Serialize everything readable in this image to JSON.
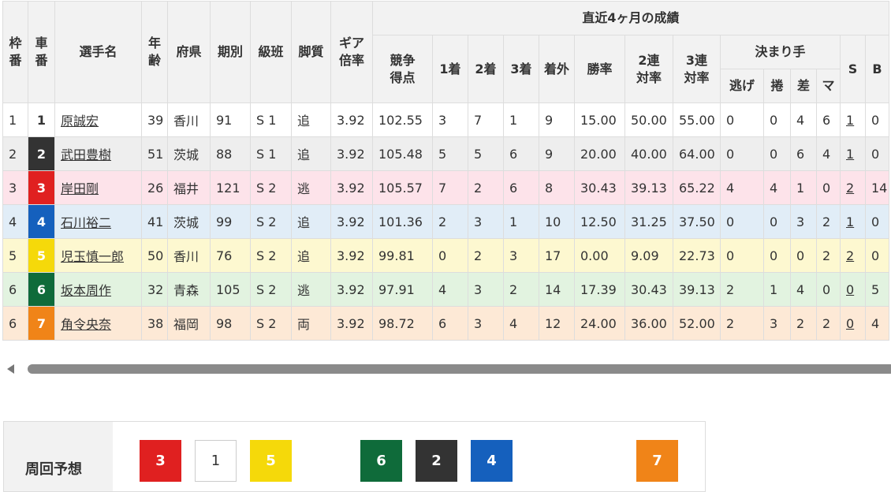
{
  "header": {
    "waku": "枠番",
    "sha": "車番",
    "name": "選手名",
    "age": "年齢",
    "pref": "府県",
    "term": "期別",
    "class": "級班",
    "style": "脚質",
    "gear": "ギア倍率",
    "group": "直近4ヶ月の成績",
    "score": "競争得点",
    "first": "1着",
    "second": "2着",
    "third": "3着",
    "out": "着外",
    "win": "勝率",
    "ren2": "2連対率",
    "ren3": "3連対率",
    "kimarite": "決まり手",
    "nige": "逃げ",
    "makuri": "捲",
    "sashi": "差",
    "mark": "マ",
    "s": "S",
    "b": "B"
  },
  "colors": {
    "car1": "#ffffff",
    "car2": "#333333",
    "car3": "#e02020",
    "car4": "#1560bd",
    "car5": "#f5d90a",
    "car6": "#0f6b3a",
    "car7": "#f08418",
    "row1": "#ffffff",
    "row2": "#eeeeee",
    "row3": "#fde3ea",
    "row4": "#e1edf7",
    "row5": "#fdf8d0",
    "row6": "#e2f3e0",
    "row7": "#fde9d6"
  },
  "rows": [
    {
      "waku": "1",
      "car": "1",
      "name": "原誠宏",
      "age": "39",
      "pref": "香川",
      "term": "91",
      "class": "S 1",
      "style": "追",
      "gear": "3.92",
      "score": "102.55",
      "first": "3",
      "second": "7",
      "third": "1",
      "out": "9",
      "win": "15.00",
      "ren2": "50.00",
      "ren3": "55.00",
      "nige": "0",
      "makuri": "0",
      "sashi": "4",
      "mark": "6",
      "s": "1",
      "b": "0"
    },
    {
      "waku": "2",
      "car": "2",
      "name": "武田豊樹",
      "age": "51",
      "pref": "茨城",
      "term": "88",
      "class": "S 1",
      "style": "追",
      "gear": "3.92",
      "score": "105.48",
      "first": "5",
      "second": "5",
      "third": "6",
      "out": "9",
      "win": "20.00",
      "ren2": "40.00",
      "ren3": "64.00",
      "nige": "0",
      "makuri": "0",
      "sashi": "6",
      "mark": "4",
      "s": "1",
      "b": "0"
    },
    {
      "waku": "3",
      "car": "3",
      "name": "岸田剛",
      "age": "26",
      "pref": "福井",
      "term": "121",
      "class": "S 2",
      "style": "逃",
      "gear": "3.92",
      "score": "105.57",
      "first": "7",
      "second": "2",
      "third": "6",
      "out": "8",
      "win": "30.43",
      "ren2": "39.13",
      "ren3": "65.22",
      "nige": "4",
      "makuri": "4",
      "sashi": "1",
      "mark": "0",
      "s": "2",
      "b": "14"
    },
    {
      "waku": "4",
      "car": "4",
      "name": "石川裕二",
      "age": "41",
      "pref": "茨城",
      "term": "99",
      "class": "S 2",
      "style": "追",
      "gear": "3.92",
      "score": "101.36",
      "first": "2",
      "second": "3",
      "third": "1",
      "out": "10",
      "win": "12.50",
      "ren2": "31.25",
      "ren3": "37.50",
      "nige": "0",
      "makuri": "0",
      "sashi": "3",
      "mark": "2",
      "s": "1",
      "b": "0"
    },
    {
      "waku": "5",
      "car": "5",
      "name": "児玉慎一郎",
      "age": "50",
      "pref": "香川",
      "term": "76",
      "class": "S 2",
      "style": "追",
      "gear": "3.92",
      "score": "99.81",
      "first": "0",
      "second": "2",
      "third": "3",
      "out": "17",
      "win": "0.00",
      "ren2": "9.09",
      "ren3": "22.73",
      "nige": "0",
      "makuri": "0",
      "sashi": "0",
      "mark": "2",
      "s": "2",
      "b": "0"
    },
    {
      "waku": "6",
      "car": "6",
      "name": "坂本周作",
      "age": "32",
      "pref": "青森",
      "term": "105",
      "class": "S 2",
      "style": "逃",
      "gear": "3.92",
      "score": "97.91",
      "first": "4",
      "second": "3",
      "third": "2",
      "out": "14",
      "win": "17.39",
      "ren2": "30.43",
      "ren3": "39.13",
      "nige": "2",
      "makuri": "1",
      "sashi": "4",
      "mark": "0",
      "s": "0",
      "b": "5"
    },
    {
      "waku": "6",
      "car": "7",
      "name": "角令央奈",
      "age": "38",
      "pref": "福岡",
      "term": "98",
      "class": "S 2",
      "style": "両",
      "gear": "3.92",
      "score": "98.72",
      "first": "6",
      "second": "3",
      "third": "4",
      "out": "12",
      "win": "24.00",
      "ren2": "36.00",
      "ren3": "52.00",
      "nige": "2",
      "makuri": "3",
      "sashi": "2",
      "mark": "2",
      "s": "0",
      "b": "4"
    }
  ],
  "forecast": {
    "label": "周回予想",
    "cars": [
      "3",
      "1",
      "5",
      "6",
      "2",
      "4",
      "7"
    ]
  }
}
